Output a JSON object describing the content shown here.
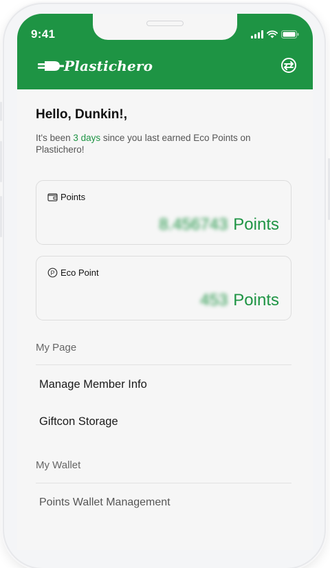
{
  "status_bar": {
    "time": "9:41"
  },
  "header": {
    "logo_text": "Plastichero",
    "action_icon": "switch-arrows-icon"
  },
  "colors": {
    "brand": "#1e9444",
    "accent_text": "#1e9444"
  },
  "greeting": {
    "title": "Hello, Dunkin!,",
    "sub_prefix": "It's been ",
    "sub_highlight": "3 days",
    "sub_suffix": " since you last earned Eco Points on Plastichero!"
  },
  "cards": {
    "points": {
      "label": "Points",
      "value": "8.456743",
      "unit": "Points",
      "icon": "wallet-icon"
    },
    "eco": {
      "label": "Eco Point",
      "value": "453",
      "unit": "Points",
      "icon": "circle-p-icon"
    }
  },
  "my_page": {
    "title": "My Page",
    "items": [
      "Manage Member Info",
      "Giftcon Storage"
    ]
  },
  "my_wallet": {
    "title": "My Wallet",
    "items": [
      "Points Wallet Management"
    ]
  }
}
